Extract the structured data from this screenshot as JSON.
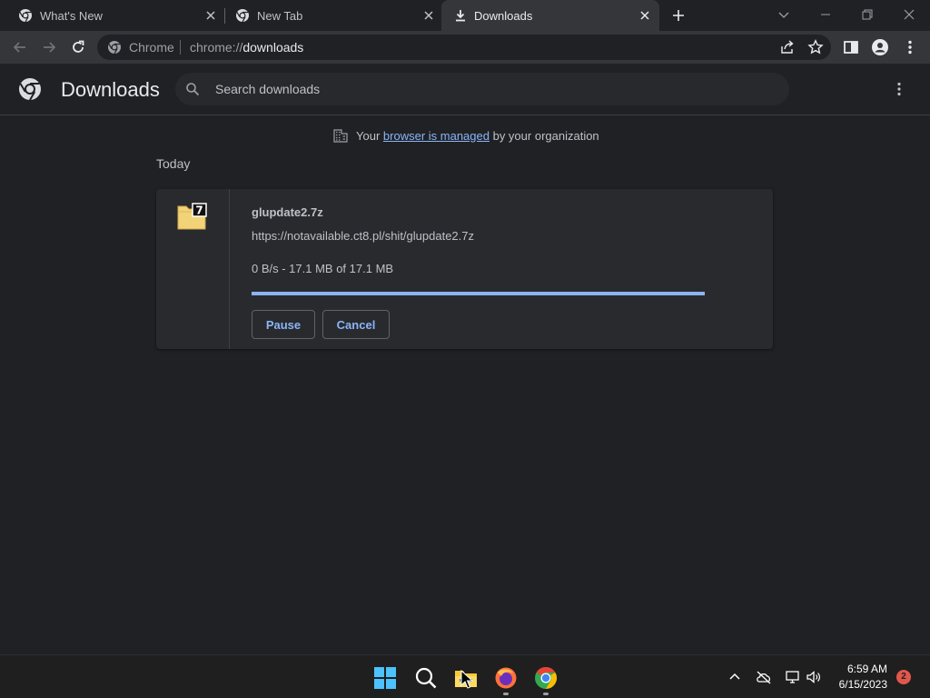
{
  "tabs": [
    {
      "title": "What's New",
      "icon": "chrome-icon"
    },
    {
      "title": "New Tab",
      "icon": "chrome-icon"
    },
    {
      "title": "Downloads",
      "icon": "download-icon",
      "active": true
    }
  ],
  "toolbar": {
    "omnibox_chip": "Chrome",
    "url_scheme": "chrome://",
    "url_host": "downloads"
  },
  "downloads": {
    "title": "Downloads",
    "search_placeholder": "Search downloads",
    "managed_prefix": "Your",
    "managed_link": "browser is managed",
    "managed_suffix": "by your organization",
    "section_label": "Today",
    "item": {
      "file_name": "glupdate2.7z",
      "url": "https://notavailable.ct8.pl/shit/glupdate2.7z",
      "status": "0 B/s - 17.1 MB of 17.1 MB",
      "progress_fraction": 1.0,
      "pause_label": "Pause",
      "cancel_label": "Cancel",
      "icon_badge": "7"
    }
  },
  "taskbar": {
    "time": "6:59 AM",
    "date": "6/15/2023",
    "notification_count": "2"
  },
  "colors": {
    "accent": "#8ab4f8",
    "background": "#202124",
    "toolbar": "#35363a"
  }
}
